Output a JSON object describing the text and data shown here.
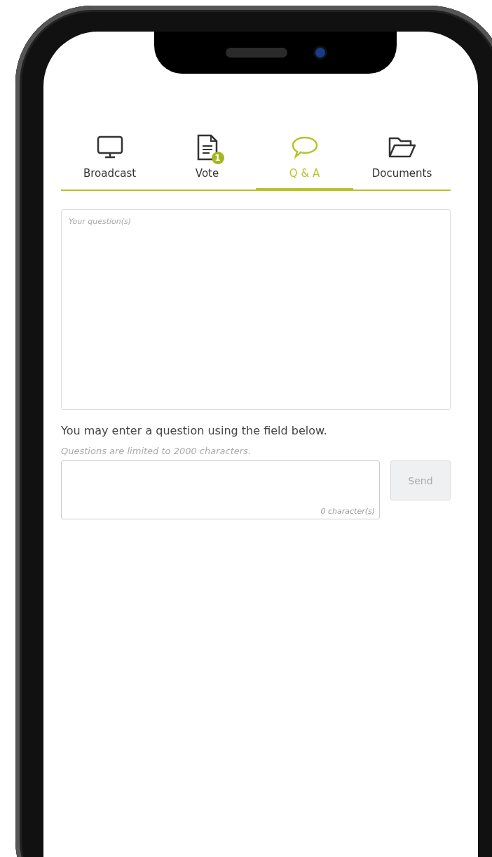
{
  "tabs": [
    {
      "label": "Broadcast",
      "kind": "monitor",
      "selected": false
    },
    {
      "label": "Vote",
      "kind": "document",
      "selected": false,
      "badge": "1"
    },
    {
      "label": "Q & A",
      "kind": "speech",
      "selected": true
    },
    {
      "label": "Documents",
      "kind": "folder",
      "selected": false
    }
  ],
  "questions_box": {
    "placeholder": "Your question(s)"
  },
  "instruction": "You may enter a question using the field below.",
  "question_input": {
    "hint": "Questions are limited to 2000  characters.",
    "counter": "0 character(s)"
  },
  "send_button": {
    "label": "Send",
    "disabled": true
  }
}
